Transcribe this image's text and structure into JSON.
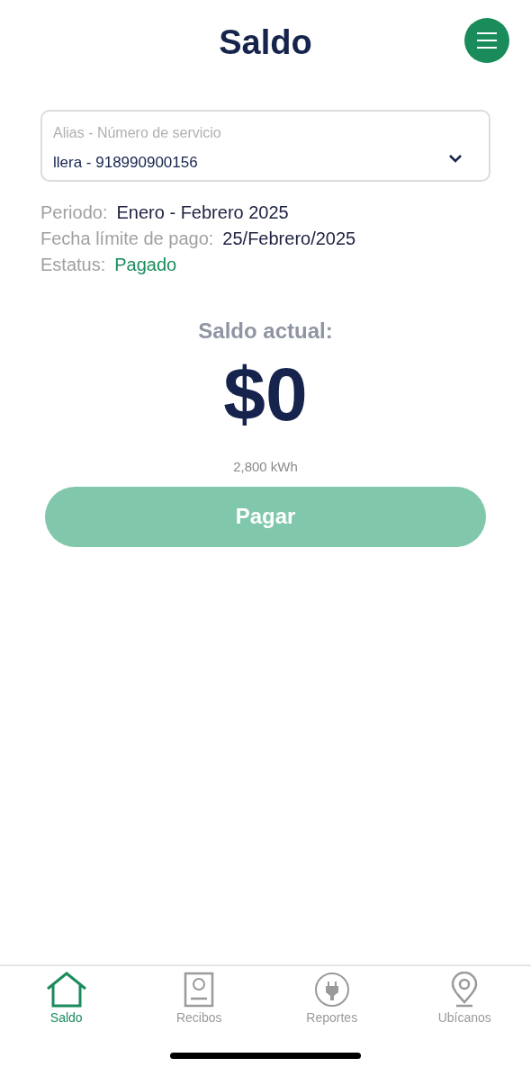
{
  "header": {
    "title": "Saldo"
  },
  "service_select": {
    "label": "Alias - Número de servicio",
    "value": "llera - 918990900156"
  },
  "details": [
    {
      "label": "Periodo:",
      "value": "Enero - Febrero 2025",
      "kind": "plain"
    },
    {
      "label": "Fecha límite de pago:",
      "value": "25/Febrero/2025",
      "kind": "plain"
    },
    {
      "label": "Estatus:",
      "value": "Pagado",
      "kind": "status"
    }
  ],
  "balance": {
    "label": "Saldo actual:",
    "amount": "$0",
    "consumption": "2,800 kWh"
  },
  "pay_button": {
    "label": "Pagar",
    "disabled": true
  },
  "tabs": [
    {
      "label": "Saldo",
      "kind": "home",
      "selected": true
    },
    {
      "label": "Recibos",
      "kind": "receipt",
      "selected": false
    },
    {
      "label": "Reportes",
      "kind": "plug",
      "selected": false
    },
    {
      "label": "Ubícanos",
      "kind": "pin",
      "selected": false
    }
  ]
}
